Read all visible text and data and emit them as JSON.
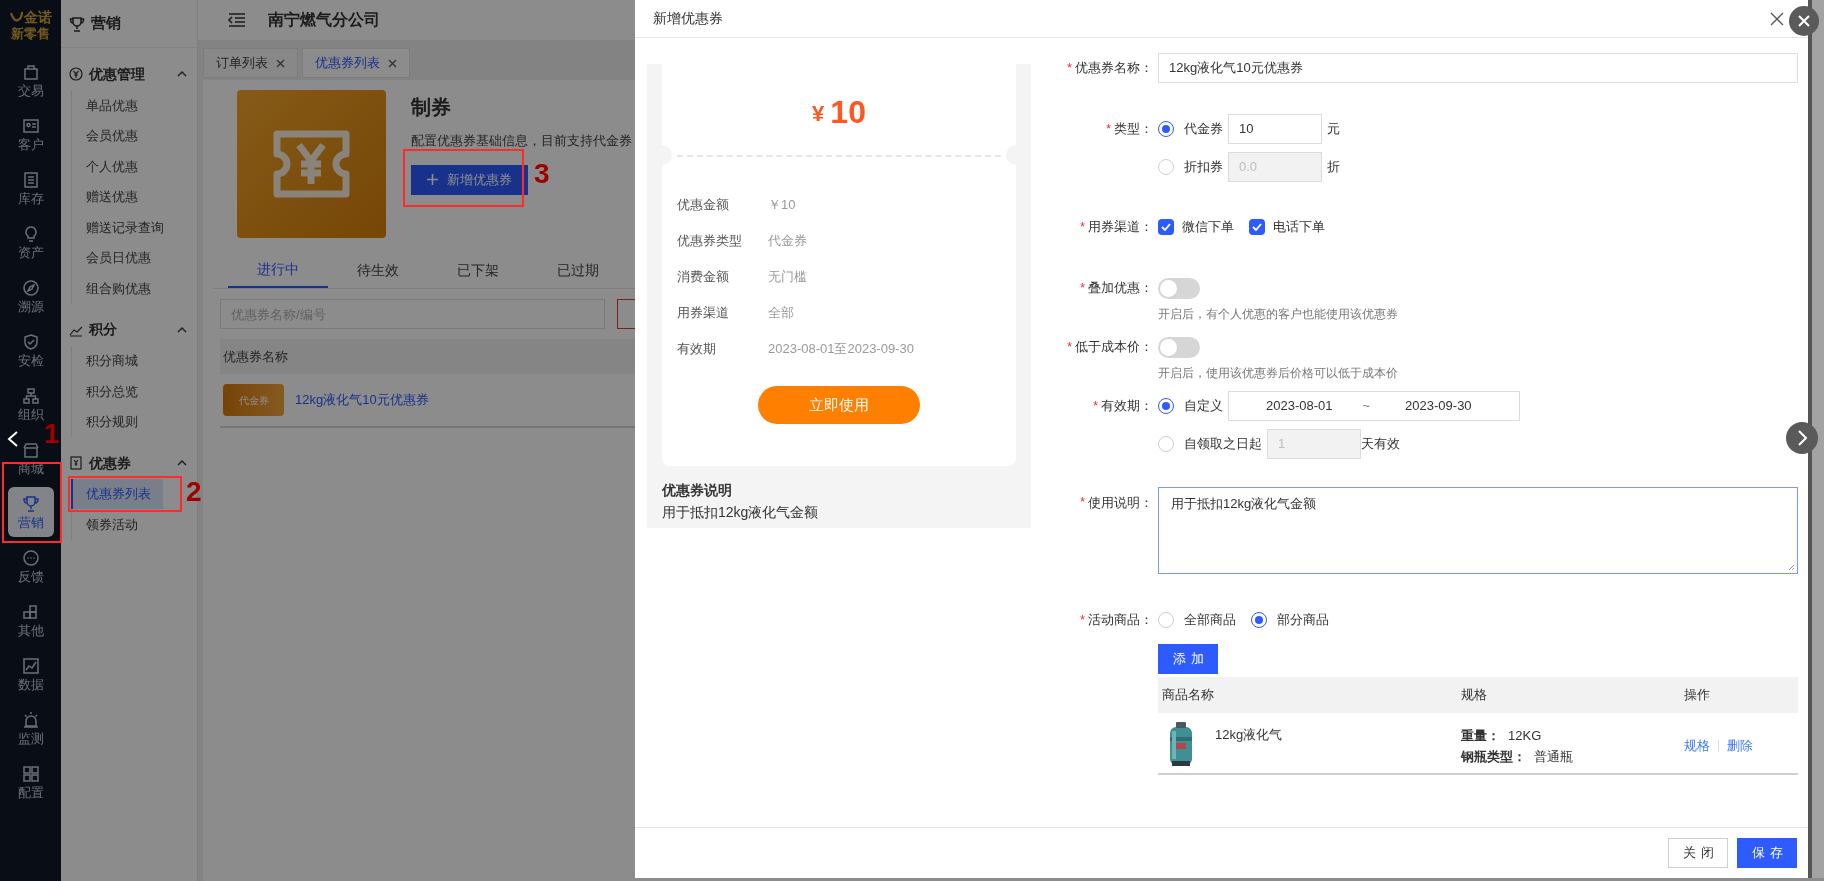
{
  "rail": {
    "logo": "金诺",
    "subtitle": "新零售",
    "items": [
      {
        "label": "交易",
        "selected": false
      },
      {
        "label": "客户",
        "selected": false
      },
      {
        "label": "库存",
        "selected": false
      },
      {
        "label": "资产",
        "selected": false
      },
      {
        "label": "溯源",
        "selected": false
      },
      {
        "label": "安检",
        "selected": false
      },
      {
        "label": "组织",
        "selected": false
      },
      {
        "label": "商城",
        "selected": false
      },
      {
        "label": "营销",
        "selected": true
      },
      {
        "label": "反馈",
        "selected": false
      },
      {
        "label": "其他",
        "selected": false
      },
      {
        "label": "数据",
        "selected": false
      },
      {
        "label": "监测",
        "selected": false
      },
      {
        "label": "配置",
        "selected": false
      }
    ]
  },
  "sidebar": {
    "title": "营销",
    "groups": [
      {
        "label": "优惠管理",
        "expanded": true,
        "items": [
          {
            "label": "单品优惠",
            "selected": false
          },
          {
            "label": "会员优惠",
            "selected": false
          },
          {
            "label": "个人优惠",
            "selected": false
          },
          {
            "label": "赠送优惠",
            "selected": false
          },
          {
            "label": "赠送记录查询",
            "selected": false
          },
          {
            "label": "会员日优惠",
            "selected": false
          },
          {
            "label": "组合购优惠",
            "selected": false
          }
        ]
      },
      {
        "label": "积分",
        "expanded": true,
        "items": [
          {
            "label": "积分商城",
            "selected": false
          },
          {
            "label": "积分总览",
            "selected": false
          },
          {
            "label": "积分规则",
            "selected": false
          }
        ]
      },
      {
        "label": "优惠券",
        "expanded": true,
        "items": [
          {
            "label": "优惠券列表",
            "selected": true
          },
          {
            "label": "领券活动",
            "selected": false
          }
        ]
      }
    ]
  },
  "header": {
    "company": "南宁燃气分公司"
  },
  "tabs": [
    {
      "label": "订单列表",
      "selected": false
    },
    {
      "label": "优惠券列表",
      "selected": true
    }
  ],
  "hero": {
    "title": "制券",
    "description": "配置优惠券基础信息，目前支持代金券",
    "button": "新增优惠券"
  },
  "status_tabs": [
    {
      "label": "进行中",
      "selected": true
    },
    {
      "label": "待生效",
      "selected": false
    },
    {
      "label": "已下架",
      "selected": false
    },
    {
      "label": "已过期",
      "selected": false
    }
  ],
  "search": {
    "placeholder": "优惠券名称/编号"
  },
  "table": {
    "columns": [
      "优惠券名称"
    ],
    "rows": [
      {
        "badge": "代金券",
        "name": "12kg液化气10元优惠券"
      }
    ]
  },
  "annotations": [
    {
      "label": "1"
    },
    {
      "label": "2"
    },
    {
      "label": "3"
    }
  ],
  "modal": {
    "title": "新增优惠券",
    "preview": {
      "currency": "¥",
      "amount": "10",
      "rows": [
        {
          "label": "优惠金额",
          "value": "￥10"
        },
        {
          "label": "优惠券类型",
          "value": "代金券"
        },
        {
          "label": "消费金额",
          "value": "无门槛"
        },
        {
          "label": "用券渠道",
          "value": "全部"
        },
        {
          "label": "有效期",
          "value": "2023-08-01至2023-09-30"
        }
      ],
      "button": "立即使用",
      "note_title": "优惠券说明",
      "note": "用于抵扣12kg液化气金额"
    },
    "form": {
      "name": {
        "required": "*",
        "label": "优惠券名称：",
        "value": "12kg液化气10元优惠券"
      },
      "type": {
        "required": "*",
        "label": "类型：",
        "options": [
          {
            "label": "代金券",
            "selected": true,
            "disabled": false,
            "value": "10",
            "unit": "元"
          },
          {
            "label": "折扣券",
            "selected": false,
            "disabled": true,
            "placeholder": "0.0",
            "unit": "折"
          }
        ]
      },
      "channels": {
        "required": "*",
        "label": "用券渠道：",
        "options": [
          {
            "label": "微信下单",
            "checked": true
          },
          {
            "label": "电话下单",
            "checked": true
          }
        ]
      },
      "switches": [
        {
          "required": "*",
          "label": "叠加优惠：",
          "on": false,
          "hint": "开启后，有个人优惠的客户也能使用该优惠券"
        },
        {
          "required": "*",
          "label": "低于成本价：",
          "on": false,
          "hint": "开启后，使用该优惠券后价格可以低于成本价"
        }
      ],
      "validity": {
        "required": "*",
        "label": "有效期：",
        "options": [
          {
            "kind": "range",
            "label": "自定义",
            "selected": true,
            "start": "2023-08-01",
            "separator": "~",
            "end": "2023-09-30"
          },
          {
            "kind": "days",
            "label": "自领取之日起",
            "selected": false,
            "disabled": true,
            "placeholder": "1",
            "unit": "天有效"
          }
        ]
      },
      "description": {
        "required": "*",
        "label": "使用说明：",
        "value": "用于抵扣12kg液化气金额"
      },
      "products": {
        "required": "*",
        "label": "活动商品：",
        "options": [
          {
            "label": "全部商品",
            "selected": false
          },
          {
            "label": "部分商品",
            "selected": true
          }
        ],
        "add_button": "添加",
        "columns": [
          "商品名称",
          "规格",
          "操作"
        ],
        "rows": [
          {
            "name": "12kg液化气",
            "specs": [
              {
                "key": "重量：",
                "value": "12KG"
              },
              {
                "key": "钢瓶类型：",
                "value": "普通瓶"
              }
            ],
            "actions": [
              "规格",
              "删除"
            ]
          }
        ]
      }
    },
    "footer": [
      {
        "label": "关闭",
        "primary": false
      },
      {
        "label": "保存",
        "primary": true
      }
    ]
  }
}
